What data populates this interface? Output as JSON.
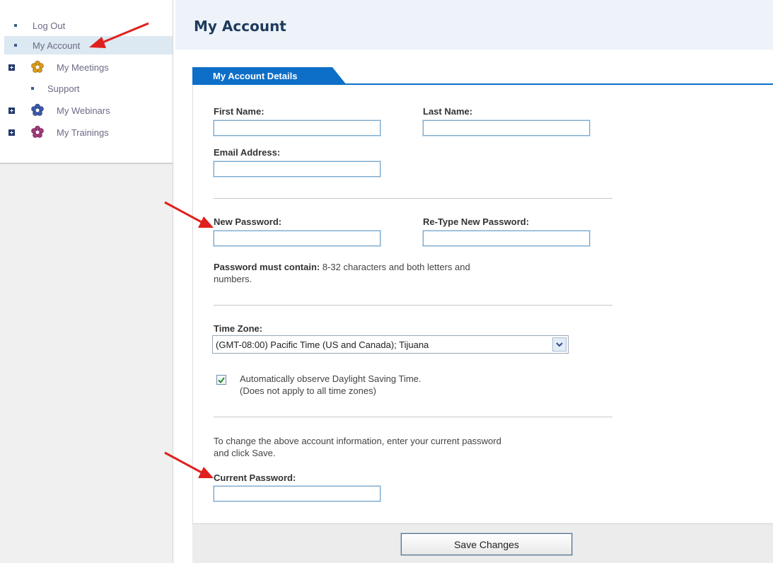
{
  "sidebar": {
    "items": [
      {
        "label": "Log Out"
      },
      {
        "label": "My Account"
      },
      {
        "label": "My Meetings"
      },
      {
        "label": "Support"
      },
      {
        "label": "My Webinars"
      },
      {
        "label": "My Trainings"
      }
    ],
    "icons": [
      "meetings-flower-icon",
      "webinars-flower-icon",
      "trainings-flower-icon"
    ],
    "colors": {
      "meetings": "#d99a1b",
      "webinars": "#3b5aa6",
      "trainings": "#a03a7a"
    }
  },
  "header": {
    "title": "My Account"
  },
  "tab": {
    "label": "My Account Details"
  },
  "form": {
    "first_name_label": "First Name:",
    "last_name_label": "Last Name:",
    "email_label": "Email Address:",
    "new_password_label": "New Password:",
    "retype_password_label": "Re-Type New Password:",
    "password_rule_bold": "Password must contain:",
    "password_rule_line1": " 8-32 characters and both letters and",
    "password_rule_line2": "numbers.",
    "timezone_label": "Time Zone:",
    "timezone_value": "(GMT-08:00) Pacific Time (US and Canada); Tijuana",
    "dst_line1": "Automatically observe Daylight Saving Time.",
    "dst_line2": "(Does not apply to all time zones)",
    "change_info_line1": "To change the above account information, enter your current password",
    "change_info_line2": "and click Save.",
    "current_password_label": "Current Password:",
    "save_label": "Save Changes"
  },
  "theme": {
    "accent": "#0d6fc8",
    "title_color": "#1f3b5c",
    "annotation_arrow": "#e0201c"
  }
}
